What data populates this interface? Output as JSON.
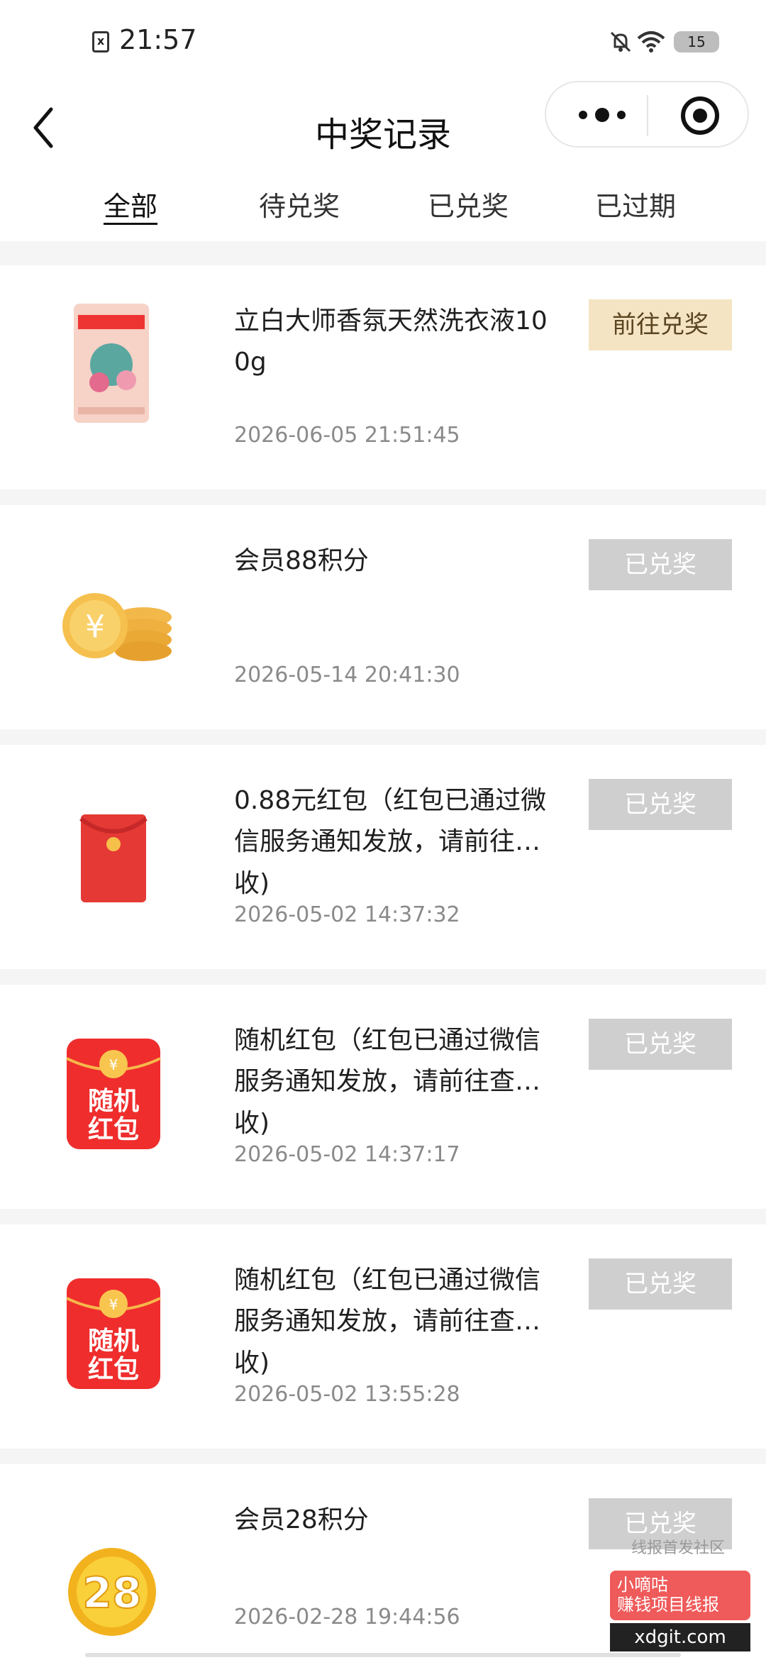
{
  "status_bar": {
    "time": "21:57",
    "battery": "15"
  },
  "nav": {
    "title": "中奖记录"
  },
  "tabs": [
    "全部",
    "待兑奖",
    "已兑奖",
    "已过期"
  ],
  "records": [
    {
      "title": "立白大师香氛天然洗衣液100g",
      "tail": "",
      "date": "2026-06-05 21:51:45",
      "button": "前往兑奖",
      "thumb": "detergent-bag-icon"
    },
    {
      "title": "会员88积分",
      "tail": "",
      "date": "2026-05-14 20:41:30",
      "button": "已兑奖",
      "thumb": "gold-coins-icon"
    },
    {
      "title": "0.88元红包（红包已通过微信服务通知发放，请前往…",
      "tail": "收)",
      "date": "2026-05-02 14:37:32",
      "button": "已兑奖",
      "thumb": "red-envelope-icon"
    },
    {
      "title": "随机红包（红包已通过微信服务通知发放，请前往查…",
      "tail": "收)",
      "date": "2026-05-02 14:37:17",
      "button": "已兑奖",
      "thumb": "random-red-packet-icon",
      "thumb_text": "随机红包"
    },
    {
      "title": "随机红包（红包已通过微信服务通知发放，请前往查…",
      "tail": "收)",
      "date": "2026-05-02 13:55:28",
      "button": "已兑奖",
      "thumb": "random-red-packet-icon",
      "thumb_text": "随机红包"
    },
    {
      "title": "会员28积分",
      "tail": "",
      "date": "2026-02-28 19:44:56",
      "button": "已兑奖",
      "thumb": "gold-coin-28-icon",
      "thumb_text": "28"
    }
  ],
  "watermark": {
    "line1": "线报首发社区",
    "brand": "小嘀咕",
    "sub": "赚钱项目线报",
    "site": "xdgit.com"
  },
  "colors": {
    "accent_gold": "#f4e4c3",
    "disabled_btn": "#cfcfcf",
    "date_gray": "#8a8a8a"
  }
}
